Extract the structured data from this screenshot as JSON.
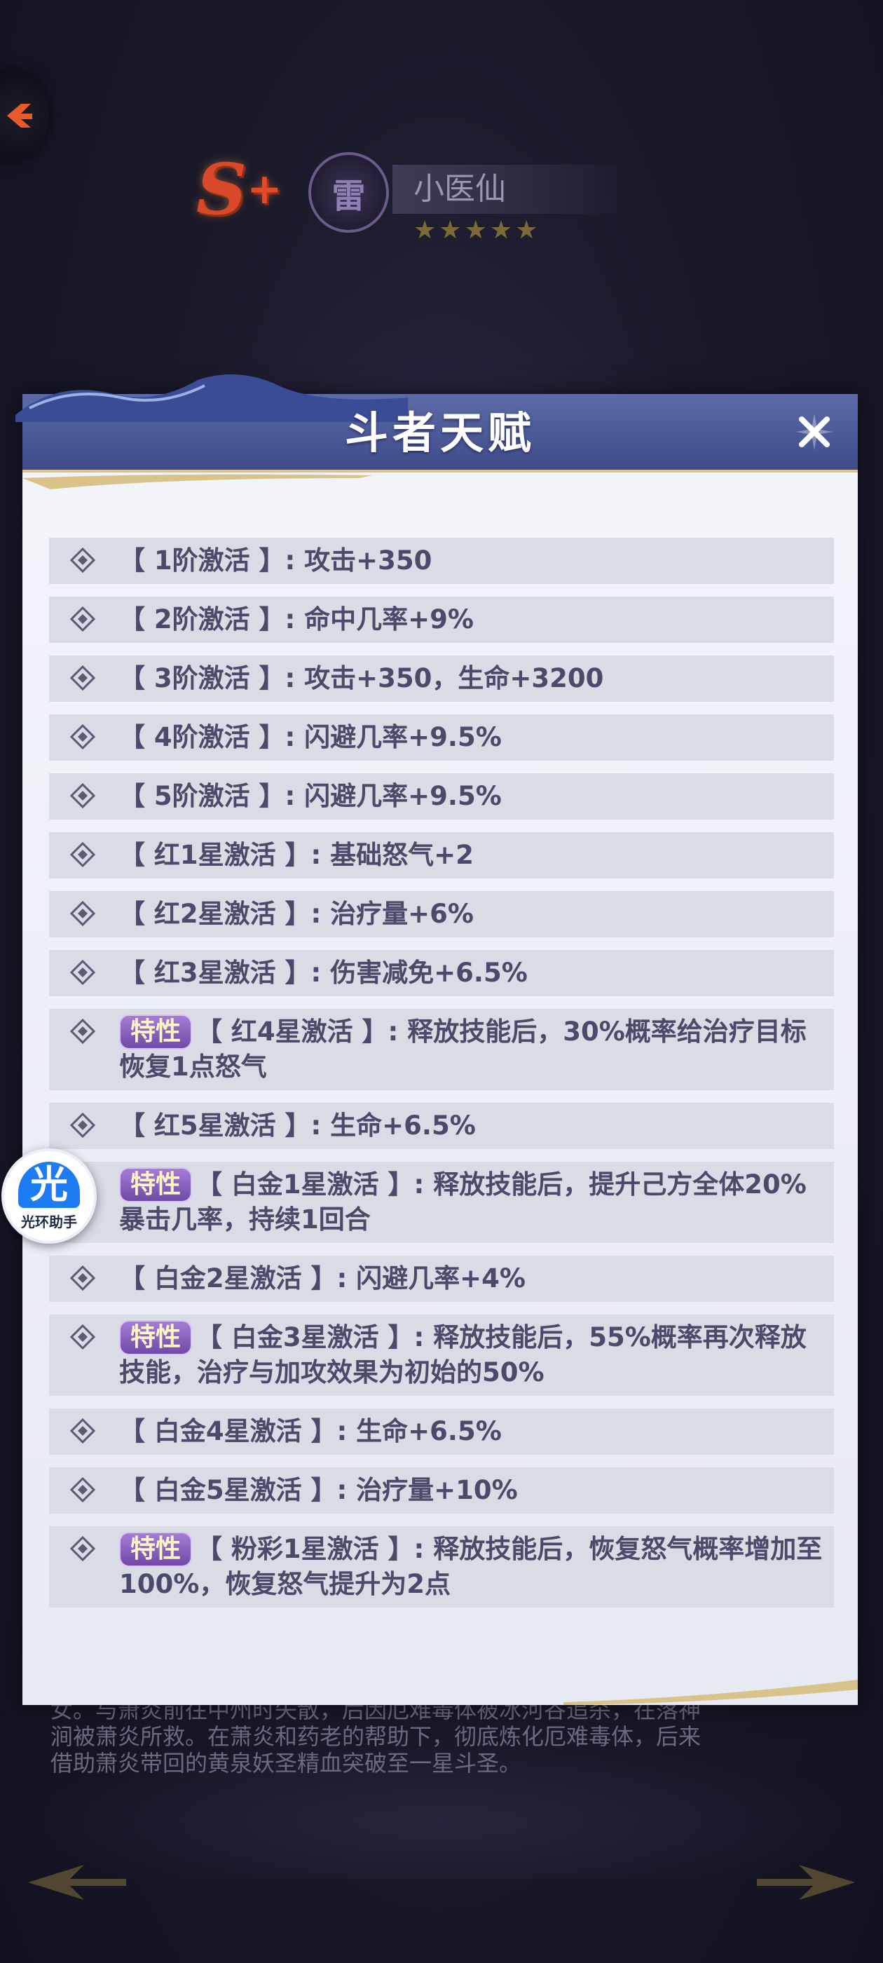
{
  "hero": {
    "rank": "S",
    "rank_plus": "+",
    "element": "雷",
    "name": "小医仙",
    "stars": [
      "★",
      "★",
      "★",
      "★",
      "★"
    ]
  },
  "modal": {
    "title": "斗者天赋",
    "trait_label": "特性",
    "rows": [
      {
        "trait": false,
        "text": "【 1阶激活 】: 攻击+350"
      },
      {
        "trait": false,
        "text": "【 2阶激活 】: 命中几率+9%"
      },
      {
        "trait": false,
        "text": "【 3阶激活 】: 攻击+350，生命+3200"
      },
      {
        "trait": false,
        "text": "【 4阶激活 】: 闪避几率+9.5%"
      },
      {
        "trait": false,
        "text": "【 5阶激活 】: 闪避几率+9.5%"
      },
      {
        "trait": false,
        "text": "【 红1星激活 】: 基础怒气+2"
      },
      {
        "trait": false,
        "text": "【 红2星激活 】: 治疗量+6%"
      },
      {
        "trait": false,
        "text": "【 红3星激活 】: 伤害减免+6.5%"
      },
      {
        "trait": true,
        "text": "【 红4星激活 】: 释放技能后，30%概率给治疗目标恢复1点怒气"
      },
      {
        "trait": false,
        "text": "【 红5星激活 】: 生命+6.5%"
      },
      {
        "trait": true,
        "text": "【 白金1星激活 】: 释放技能后，提升己方全体20%暴击几率，持续1回合"
      },
      {
        "trait": false,
        "text": "【 白金2星激活 】: 闪避几率+4%"
      },
      {
        "trait": true,
        "text": "【 白金3星激活 】: 释放技能后，55%概率再次释放技能，治疗与加攻效果为初始的50%"
      },
      {
        "trait": false,
        "text": "【 白金4星激活 】: 生命+6.5%"
      },
      {
        "trait": false,
        "text": "【 白金5星激活 】: 治疗量+10%"
      },
      {
        "trait": true,
        "text": "【 粉彩1星激活 】: 释放技能后，恢复怒气概率增加至100%，恢复怒气提升为2点"
      }
    ]
  },
  "bio": {
    "text": "女。与萧炎前往中州时失散，后因厄难毒体被冰河谷追杀，在落神\n涧被萧炎所救。在萧炎和药老的帮助下，彻底炼化厄难毒体，后来\n借助萧炎带回的黄泉妖圣精血突破至一星斗圣。"
  },
  "assistant": {
    "logo_glyph": "光",
    "label": "光环助手"
  },
  "colors": {
    "header_blue": "#4a58974",
    "row_bg": "#d9dbe5",
    "trait_purple": "#8a5fc0",
    "text": "#4b4a6a",
    "gold": "#d8c38a"
  },
  "icons": {
    "back": "back-arrow-icon",
    "close": "close-x-icon",
    "bullet": "diamond-bullet-icon"
  }
}
